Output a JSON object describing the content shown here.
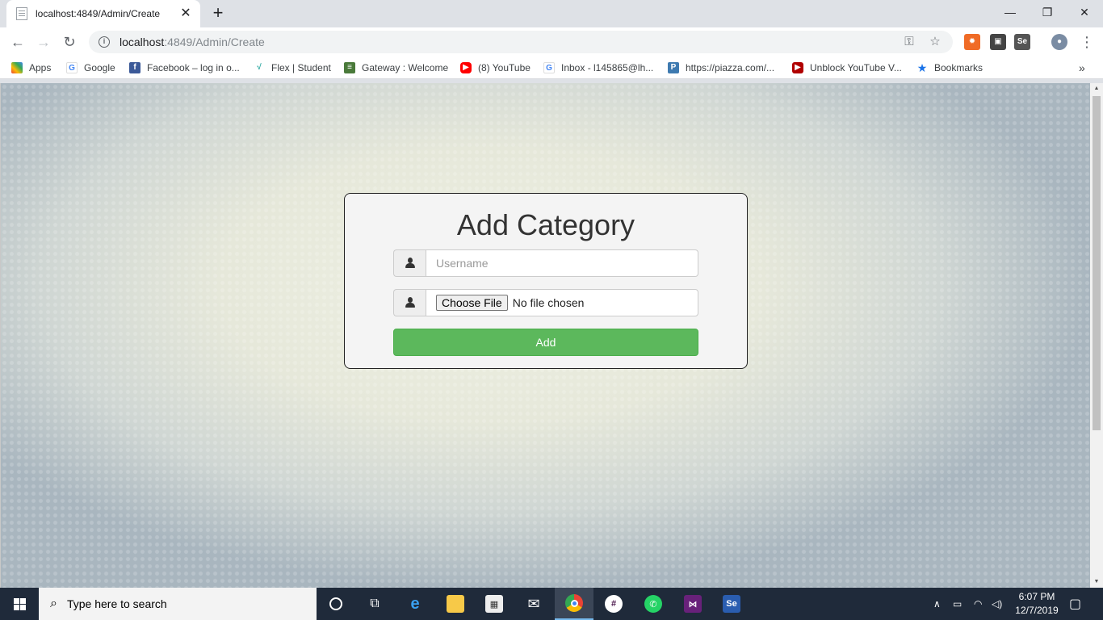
{
  "browser": {
    "tab_title": "localhost:4849/Admin/Create",
    "url_host": "localhost",
    "url_path": ":4849/Admin/Create",
    "bookmarks": [
      {
        "label": "Apps",
        "icon": "apps-grid-icon"
      },
      {
        "label": "Google",
        "icon": "google-icon"
      },
      {
        "label": "Facebook – log in o...",
        "icon": "facebook-icon"
      },
      {
        "label": "Flex | Student",
        "icon": "flex-icon"
      },
      {
        "label": "Gateway : Welcome",
        "icon": "gateway-icon"
      },
      {
        "label": "(8) YouTube",
        "icon": "youtube-icon"
      },
      {
        "label": "Inbox - l145865@lh...",
        "icon": "google-icon"
      },
      {
        "label": "https://piazza.com/...",
        "icon": "piazza-icon"
      },
      {
        "label": "Unblock YouTube V...",
        "icon": "youtube-icon"
      },
      {
        "label": "Bookmarks",
        "icon": "star-icon"
      }
    ],
    "overflow_label": "»"
  },
  "form": {
    "title": "Add Category",
    "username_placeholder": "Username",
    "choose_file_label": "Choose File",
    "no_file_text": "No file chosen",
    "submit_label": "Add"
  },
  "taskbar": {
    "search_placeholder": "Type here to search",
    "time": "6:07 PM",
    "date": "12/7/2019",
    "accent": "#76b9ed"
  },
  "colors": {
    "submit_button": "#5cb85c",
    "card_border": "#222222"
  }
}
